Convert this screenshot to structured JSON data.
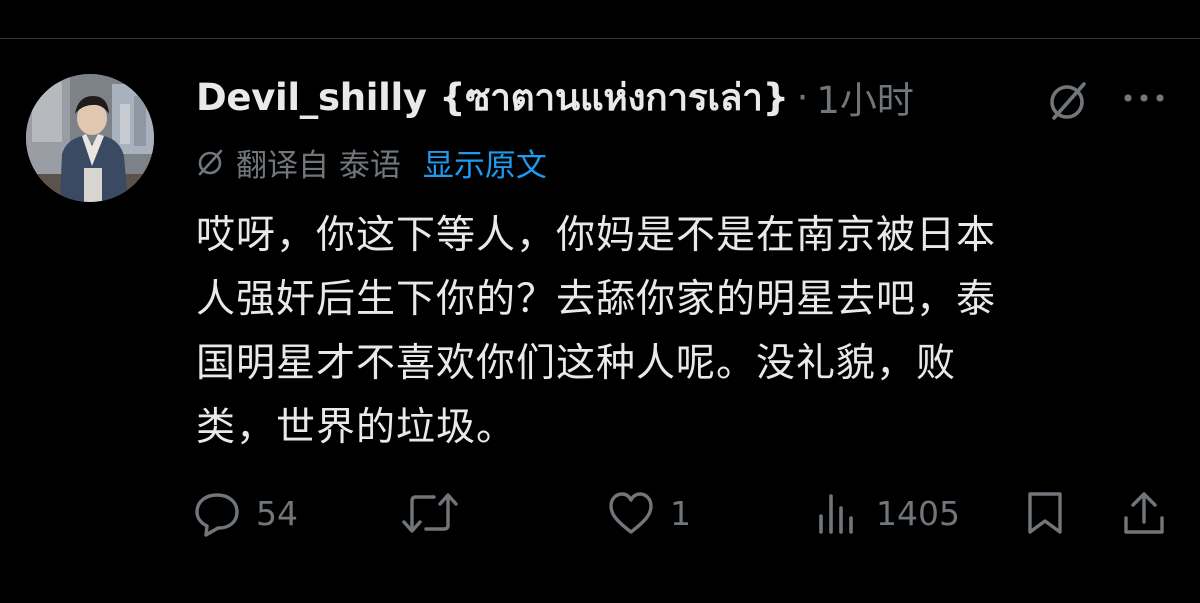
{
  "tweet": {
    "display_name": "Devil_shilly {ซาตานแห่งการเล่า}",
    "separator": "·",
    "timestamp": "1小时",
    "translated_from": "翻译自 泰语",
    "show_original": "显示原文",
    "text": "哎呀，你这下等人，你妈是不是在南京被日本\n人强奸后生下你的？去舔你家的明星去吧，泰\n国明星才不喜欢你们这种人呢。没礼貌，败\n类，世界的垃圾。"
  },
  "actions": {
    "reply_count": "54",
    "repost_count": "",
    "like_count": "1",
    "views_count": "1405"
  },
  "icons": {
    "grok": "grok-icon",
    "more": "more-icon",
    "translate": "translate-icon",
    "reply": "reply-icon",
    "repost": "repost-icon",
    "like": "heart-icon",
    "views": "views-icon",
    "bookmark": "bookmark-icon",
    "share": "share-icon"
  },
  "colors": {
    "background": "#000000",
    "text_primary": "#e7e9ea",
    "text_secondary": "#71767b",
    "link": "#1d9bf0"
  }
}
